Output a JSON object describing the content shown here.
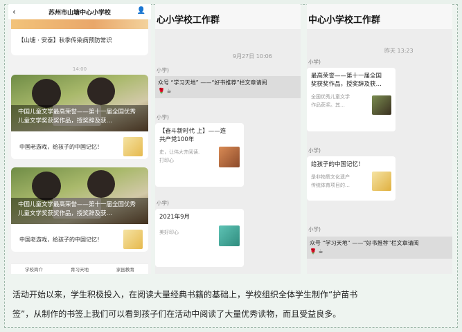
{
  "left_phone": {
    "title": "苏州市山塘中心小学校",
    "top_article": "【山塘 · 安泰】秋季传染病预防常识",
    "time": "14:00",
    "articles": [
      {
        "overlay": "中国儿童文学最高荣誉——第十一届全国优秀儿童文学奖获奖作品，授奖辞及获…",
        "subtitle": "中国老游戏，给孩子的中国记忆！"
      },
      {
        "overlay": "中国儿童文学最高荣誉——第十一届全国优秀儿童文学奖获奖作品，授奖辞及获…",
        "subtitle": "中国老游戏，给孩子的中国记忆！"
      }
    ],
    "bottom_tabs": [
      "学校简介",
      "育习天地",
      "家园教育"
    ]
  },
  "mid_chat": {
    "title": "心小学校工作群",
    "time": "9月27日 10:06",
    "sender": "小学)",
    "system_msg": "众号 “学习天地” ——“好书推荐”栏文章请阅",
    "emoji": "🌹 ☕",
    "card1_title": "【奋斗新时代 上】——连\n共产党100年",
    "card1_desc": "史，让伟大齐阅读.\n打印心",
    "card2_title": "2021年9月",
    "card2_desc": "美好印心"
  },
  "right_chat": {
    "title": "中心小学校工作群",
    "time": "昨天 13:23",
    "sender": "小学)",
    "card1_title": "最高荣誉——第十一届全国\n奖获奖作品，授奖辞及获…",
    "card1_desc": "全国优秀儿童文学\n作品获奖。其…",
    "card2_title": "给孩子的中国记忆！",
    "card2_desc": "是非物质文化遗产\n传统体育项目的…",
    "system_msg": "众号 “学习天地” ——“好书推荐”栏文章请阅",
    "emoji": "🌹 ☕"
  },
  "caption": {
    "line1": "活动开始以来，学生积极投入，在阅读大量经典书籍的基础上，学校组织全体学生制作“护苗书",
    "line2": "签”，从制作的书签上我们可以看到孩子们在活动中阅读了大量优秀读物，而且受益良多。"
  }
}
